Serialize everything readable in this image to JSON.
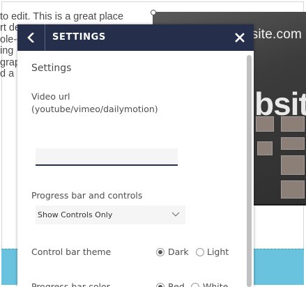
{
  "background": {
    "text_lines": [
      "to edit. This is a great place",
      "rt de",
      "ole-c",
      "ing",
      "grap",
      "d a"
    ],
    "image_caption": "bsite.com",
    "image_word": "bsite"
  },
  "panel": {
    "header": {
      "title": "SETTINGS",
      "back_icon": "chevron-left-icon",
      "close_icon": "close-icon"
    },
    "section_heading": "Settings",
    "video_url": {
      "label_line1": "Video url",
      "label_line2": "(youtube/vimeo/dailymotion)",
      "value": "",
      "placeholder": ""
    },
    "progress_controls": {
      "label": "Progress bar and controls",
      "selected": "Show Controls Only"
    },
    "control_theme": {
      "label": "Control bar theme",
      "options": [
        {
          "label": "Dark",
          "checked": true
        },
        {
          "label": "Light",
          "checked": false
        }
      ]
    },
    "progress_color": {
      "label": "Progress bar color",
      "options": [
        {
          "label": "Red",
          "checked": true
        },
        {
          "label": "White",
          "checked": false
        }
      ]
    }
  },
  "colors": {
    "header_bg": "#252f4b",
    "accent_underline": "#253049",
    "strip": "#69c3df"
  }
}
